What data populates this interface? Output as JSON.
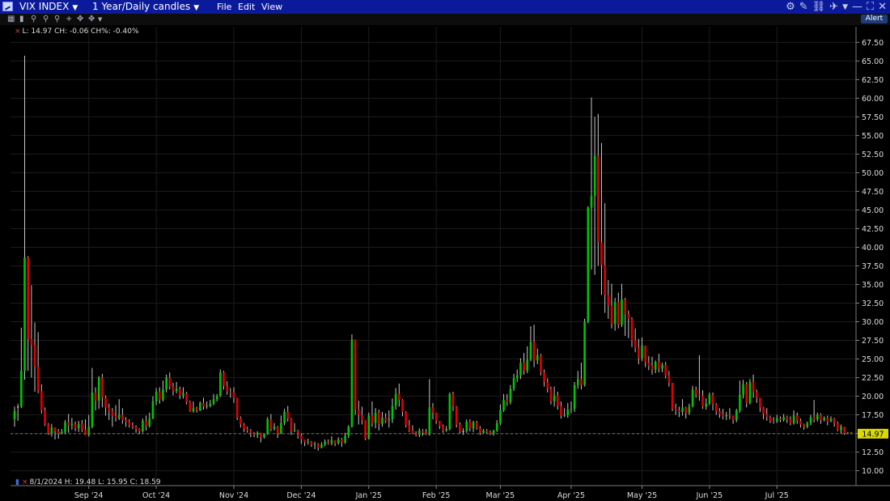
{
  "titlebar": {
    "symbol": "VIX INDEX",
    "period": "1 Year/Daily candles",
    "menu": {
      "file": "File",
      "edit": "Edit",
      "view": "View"
    },
    "alert_label": "Alert"
  },
  "legend_top": "L: 14.97 CH: -0.06 CH%: -0.40%",
  "legend_bottom": "8/1/2024  H: 19.48  L: 15.95  C: 18.59",
  "last_price_label": "14.97",
  "colors": {
    "up": "#00c400",
    "down": "#e00000",
    "doji": "#c8c8c8",
    "background": "#000000",
    "price_tag": "#dada00"
  },
  "chart_data": {
    "type": "candlestick",
    "ylim": [
      8.0,
      69.6
    ],
    "yticks": [
      10,
      12.5,
      15,
      17.5,
      20,
      22.5,
      25,
      27.5,
      30,
      32.5,
      35,
      37.5,
      40,
      42.5,
      45,
      47.5,
      50,
      52.5,
      55,
      57.5,
      60,
      62.5,
      65,
      67.5
    ],
    "ytick_labels": [
      "10.00",
      "12.50",
      "15.00",
      "17.50",
      "20.00",
      "22.50",
      "25.00",
      "27.50",
      "30.00",
      "32.50",
      "35.00",
      "37.50",
      "40.00",
      "42.50",
      "45.00",
      "47.50",
      "50.00",
      "52.50",
      "55.00",
      "57.50",
      "60.00",
      "62.50",
      "65.00",
      "67.50"
    ],
    "xticks": [
      {
        "label": "Sep '24",
        "index": 22
      },
      {
        "label": "Oct '24",
        "index": 42
      },
      {
        "label": "Nov '24",
        "index": 65
      },
      {
        "label": "Dec '24",
        "index": 85
      },
      {
        "label": "Jan '25",
        "index": 105
      },
      {
        "label": "Feb '25",
        "index": 125
      },
      {
        "label": "Mar '25",
        "index": 144
      },
      {
        "label": "Apr '25",
        "index": 165
      },
      {
        "label": "May '25",
        "index": 186
      },
      {
        "label": "Jun '25",
        "index": 206
      },
      {
        "label": "Jul '25",
        "index": 226
      }
    ],
    "last_value": 14.97,
    "candles": [
      [
        16.9,
        18.0,
        15.9,
        18.6
      ],
      [
        18.6,
        18.6,
        16.7,
        19.0
      ],
      [
        18.6,
        23.4,
        18.4,
        29.2
      ],
      [
        23.4,
        38.6,
        22.2,
        65.7
      ],
      [
        38.6,
        27.7,
        23.4,
        38.8
      ],
      [
        27.7,
        26.9,
        22.5,
        34.9
      ],
      [
        26.9,
        24.0,
        20.6,
        29.9
      ],
      [
        24.0,
        20.7,
        20.4,
        28.6
      ],
      [
        20.7,
        18.1,
        17.7,
        21.6
      ],
      [
        18.1,
        16.2,
        16.0,
        18.5
      ],
      [
        16.2,
        15.0,
        14.8,
        16.4
      ],
      [
        15.0,
        15.8,
        14.6,
        16.3
      ],
      [
        15.8,
        15.3,
        14.2,
        15.8
      ],
      [
        15.3,
        15.0,
        14.3,
        15.6
      ],
      [
        15.0,
        15.2,
        14.9,
        15.6
      ],
      [
        15.2,
        16.5,
        15.0,
        16.8
      ],
      [
        16.5,
        16.1,
        15.1,
        17.6
      ],
      [
        16.1,
        16.3,
        15.5,
        17.1
      ],
      [
        16.3,
        15.7,
        15.3,
        16.6
      ],
      [
        15.7,
        16.3,
        15.2,
        16.7
      ],
      [
        16.3,
        15.5,
        15.2,
        16.8
      ],
      [
        15.5,
        14.8,
        14.8,
        16.9
      ],
      [
        14.8,
        15.9,
        14.6,
        17.5
      ],
      [
        15.9,
        20.5,
        15.7,
        23.8
      ],
      [
        20.5,
        19.4,
        18.1,
        21.2
      ],
      [
        19.4,
        22.5,
        18.3,
        22.7
      ],
      [
        22.5,
        19.8,
        18.5,
        23.0
      ],
      [
        19.8,
        18.5,
        17.4,
        20.1
      ],
      [
        18.5,
        18.0,
        16.8,
        19.0
      ],
      [
        18.0,
        17.4,
        15.9,
        18.4
      ],
      [
        17.4,
        17.1,
        16.6,
        18.8
      ],
      [
        17.1,
        17.5,
        16.8,
        19.6
      ],
      [
        17.5,
        16.8,
        16.3,
        18.4
      ],
      [
        16.8,
        16.6,
        15.9,
        17.2
      ],
      [
        16.6,
        16.1,
        15.8,
        16.9
      ],
      [
        16.1,
        15.9,
        15.6,
        16.5
      ],
      [
        15.9,
        15.6,
        15.1,
        16.1
      ],
      [
        15.6,
        15.3,
        14.9,
        15.7
      ],
      [
        15.3,
        16.7,
        15.1,
        17.0
      ],
      [
        16.7,
        16.0,
        15.4,
        17.4
      ],
      [
        16.0,
        17.0,
        15.8,
        17.8
      ],
      [
        17.0,
        19.3,
        16.9,
        20.0
      ],
      [
        19.3,
        20.6,
        18.8,
        21.1
      ],
      [
        20.6,
        19.5,
        19.0,
        21.2
      ],
      [
        19.5,
        20.9,
        19.3,
        22.1
      ],
      [
        20.9,
        22.5,
        20.5,
        22.9
      ],
      [
        22.5,
        21.3,
        20.9,
        23.2
      ],
      [
        21.3,
        20.7,
        20.1,
        21.8
      ],
      [
        20.7,
        21.0,
        20.4,
        21.9
      ],
      [
        21.0,
        20.1,
        19.6,
        21.3
      ],
      [
        20.1,
        20.4,
        19.7,
        21.2
      ],
      [
        20.4,
        19.2,
        18.9,
        20.6
      ],
      [
        19.2,
        18.0,
        17.9,
        19.4
      ],
      [
        18.0,
        18.4,
        17.8,
        19.3
      ],
      [
        18.4,
        18.1,
        17.8,
        18.6
      ],
      [
        18.1,
        19.1,
        18.0,
        19.3
      ],
      [
        19.1,
        18.6,
        18.2,
        19.8
      ],
      [
        18.6,
        18.7,
        18.3,
        19.3
      ],
      [
        18.7,
        19.0,
        18.5,
        19.5
      ],
      [
        19.0,
        19.6,
        18.8,
        20.3
      ],
      [
        19.6,
        20.0,
        19.3,
        20.3
      ],
      [
        20.0,
        23.2,
        19.9,
        23.6
      ],
      [
        23.2,
        21.4,
        20.9,
        23.4
      ],
      [
        21.4,
        20.6,
        20.2,
        22.0
      ],
      [
        20.6,
        20.5,
        19.8,
        21.1
      ],
      [
        20.5,
        19.8,
        19.1,
        21.2
      ],
      [
        19.8,
        17.1,
        16.8,
        19.8
      ],
      [
        17.1,
        16.2,
        15.8,
        17.3
      ],
      [
        16.2,
        15.6,
        15.2,
        16.4
      ],
      [
        15.6,
        15.4,
        15.1,
        15.9
      ],
      [
        15.4,
        15.1,
        14.5,
        15.6
      ],
      [
        15.1,
        14.8,
        14.5,
        15.2
      ],
      [
        14.8,
        15.1,
        14.4,
        15.3
      ],
      [
        15.1,
        14.5,
        13.8,
        15.1
      ],
      [
        14.5,
        14.9,
        14.3,
        15.0
      ],
      [
        14.9,
        16.9,
        14.8,
        17.2
      ],
      [
        16.9,
        15.6,
        15.3,
        17.6
      ],
      [
        15.6,
        15.9,
        15.4,
        16.4
      ],
      [
        15.9,
        15.0,
        14.4,
        16.0
      ],
      [
        15.0,
        16.4,
        14.9,
        17.4
      ],
      [
        16.4,
        17.9,
        16.1,
        18.3
      ],
      [
        17.9,
        17.0,
        16.6,
        18.7
      ],
      [
        17.0,
        15.3,
        14.8,
        17.1
      ],
      [
        15.3,
        15.4,
        15.2,
        16.4
      ],
      [
        15.4,
        14.7,
        14.3,
        15.5
      ],
      [
        14.7,
        14.2,
        13.6,
        15.0
      ],
      [
        14.2,
        13.8,
        13.3,
        14.2
      ],
      [
        13.8,
        13.9,
        13.5,
        14.3
      ],
      [
        13.9,
        13.5,
        13.2,
        14.0
      ],
      [
        13.5,
        13.6,
        12.9,
        13.9
      ],
      [
        13.6,
        13.1,
        12.7,
        13.7
      ],
      [
        13.1,
        13.5,
        13.0,
        13.8
      ],
      [
        13.5,
        13.9,
        13.3,
        14.2
      ],
      [
        13.9,
        13.7,
        13.5,
        14.2
      ],
      [
        13.7,
        14.1,
        13.4,
        14.6
      ],
      [
        14.1,
        13.7,
        13.3,
        14.1
      ],
      [
        13.7,
        14.2,
        13.5,
        14.5
      ],
      [
        14.2,
        13.8,
        13.2,
        14.4
      ],
      [
        13.8,
        14.7,
        13.6,
        15.1
      ],
      [
        14.7,
        15.9,
        14.4,
        16.1
      ],
      [
        15.9,
        27.6,
        15.8,
        28.3
      ],
      [
        27.6,
        18.2,
        17.5,
        27.6
      ],
      [
        18.2,
        17.5,
        16.2,
        19.4
      ],
      [
        17.5,
        16.8,
        16.2,
        18.6
      ],
      [
        16.8,
        14.3,
        14.1,
        16.8
      ],
      [
        14.3,
        17.4,
        14.2,
        17.8
      ],
      [
        17.4,
        16.4,
        15.9,
        19.3
      ],
      [
        16.4,
        17.8,
        15.7,
        18.4
      ],
      [
        17.8,
        16.3,
        15.4,
        18.2
      ],
      [
        16.3,
        17.1,
        15.9,
        17.9
      ],
      [
        17.1,
        16.7,
        16.4,
        17.7
      ],
      [
        16.7,
        16.9,
        15.8,
        18.1
      ],
      [
        16.9,
        18.7,
        16.4,
        19.7
      ],
      [
        18.7,
        20.3,
        18.2,
        21.1
      ],
      [
        20.3,
        19.5,
        18.6,
        21.7
      ],
      [
        19.5,
        17.9,
        17.3,
        19.6
      ],
      [
        17.9,
        16.1,
        15.8,
        18.0
      ],
      [
        16.1,
        15.4,
        15.2,
        16.8
      ],
      [
        15.4,
        15.0,
        14.9,
        16.1
      ],
      [
        15.0,
        14.8,
        14.6,
        15.3
      ],
      [
        14.8,
        15.4,
        14.5,
        15.7
      ],
      [
        15.4,
        15.1,
        14.7,
        15.6
      ],
      [
        15.1,
        14.9,
        14.8,
        15.6
      ],
      [
        14.9,
        18.5,
        14.7,
        22.3
      ],
      [
        18.5,
        17.8,
        16.9,
        19.1
      ],
      [
        17.8,
        16.7,
        16.3,
        17.8
      ],
      [
        16.7,
        16.0,
        15.6,
        16.7
      ],
      [
        16.0,
        15.4,
        15.1,
        16.2
      ],
      [
        15.4,
        15.6,
        15.2,
        16.0
      ],
      [
        15.6,
        20.3,
        15.4,
        20.5
      ],
      [
        20.3,
        18.6,
        18.0,
        20.6
      ],
      [
        18.6,
        16.2,
        15.8,
        18.7
      ],
      [
        16.2,
        15.3,
        15.0,
        16.5
      ],
      [
        15.3,
        15.3,
        14.8,
        15.7
      ],
      [
        15.3,
        16.6,
        15.1,
        16.9
      ],
      [
        16.6,
        15.7,
        15.3,
        16.9
      ],
      [
        15.7,
        16.5,
        15.2,
        16.7
      ],
      [
        16.5,
        15.7,
        15.5,
        16.7
      ],
      [
        15.7,
        15.1,
        14.8,
        16.0
      ],
      [
        15.1,
        15.4,
        14.9,
        15.6
      ],
      [
        15.4,
        15.2,
        15.0,
        15.6
      ],
      [
        15.2,
        15.0,
        14.8,
        15.4
      ],
      [
        15.0,
        15.4,
        14.7,
        15.5
      ],
      [
        15.4,
        16.4,
        15.2,
        16.8
      ],
      [
        16.4,
        18.1,
        16.1,
        18.9
      ],
      [
        18.1,
        19.5,
        17.9,
        20.3
      ],
      [
        19.5,
        19.2,
        18.7,
        20.3
      ],
      [
        19.2,
        21.0,
        18.9,
        21.5
      ],
      [
        21.0,
        22.4,
        20.7,
        23.0
      ],
      [
        22.4,
        22.8,
        21.9,
        23.6
      ],
      [
        22.8,
        24.5,
        22.3,
        25.1
      ],
      [
        24.5,
        23.4,
        22.9,
        25.8
      ],
      [
        23.4,
        24.9,
        23.1,
        26.7
      ],
      [
        24.9,
        27.3,
        24.7,
        29.4
      ],
      [
        27.3,
        24.8,
        23.9,
        29.6
      ],
      [
        24.8,
        25.5,
        24.3,
        26.4
      ],
      [
        25.5,
        23.2,
        22.8,
        25.7
      ],
      [
        23.2,
        21.9,
        21.3,
        23.6
      ],
      [
        21.9,
        21.0,
        20.5,
        22.4
      ],
      [
        21.0,
        19.3,
        18.9,
        21.3
      ],
      [
        19.3,
        20.1,
        18.6,
        21.3
      ],
      [
        20.1,
        18.7,
        18.2,
        20.6
      ],
      [
        18.7,
        17.4,
        17.0,
        19.3
      ],
      [
        17.4,
        17.5,
        17.2,
        18.4
      ],
      [
        17.5,
        18.2,
        17.1,
        19.1
      ],
      [
        18.2,
        18.3,
        17.7,
        19.3
      ],
      [
        18.3,
        21.5,
        17.9,
        21.9
      ],
      [
        21.5,
        22.3,
        21.0,
        23.4
      ],
      [
        22.3,
        21.5,
        20.9,
        24.5
      ],
      [
        21.5,
        30.0,
        21.3,
        30.4
      ],
      [
        30.0,
        45.3,
        29.8,
        45.5
      ],
      [
        45.3,
        46.9,
        37.0,
        60.1
      ],
      [
        46.9,
        52.3,
        36.3,
        57.5
      ],
      [
        52.3,
        40.7,
        37.5,
        57.9
      ],
      [
        40.7,
        37.6,
        33.6,
        54.0
      ],
      [
        37.6,
        33.6,
        31.2,
        45.9
      ],
      [
        33.6,
        32.2,
        30.4,
        35.6
      ],
      [
        32.2,
        29.7,
        29.1,
        35.1
      ],
      [
        29.7,
        32.6,
        28.8,
        33.2
      ],
      [
        32.6,
        29.6,
        29.1,
        33.9
      ],
      [
        29.6,
        33.0,
        29.3,
        35.1
      ],
      [
        33.0,
        31.0,
        28.1,
        33.2
      ],
      [
        31.0,
        30.4,
        27.8,
        31.5
      ],
      [
        30.4,
        27.5,
        26.6,
        30.6
      ],
      [
        27.5,
        26.5,
        25.9,
        29.1
      ],
      [
        26.5,
        25.1,
        24.3,
        27.7
      ],
      [
        25.1,
        26.8,
        24.7,
        27.9
      ],
      [
        26.8,
        24.5,
        23.9,
        26.7
      ],
      [
        24.5,
        24.1,
        23.5,
        25.4
      ],
      [
        24.1,
        23.6,
        22.9,
        25.3
      ],
      [
        23.6,
        24.6,
        23.1,
        24.8
      ],
      [
        24.6,
        23.7,
        23.2,
        25.7
      ],
      [
        23.7,
        24.2,
        23.2,
        24.5
      ],
      [
        24.2,
        22.8,
        22.4,
        24.6
      ],
      [
        22.8,
        21.8,
        21.3,
        23.4
      ],
      [
        21.8,
        18.3,
        18.0,
        21.5
      ],
      [
        18.3,
        18.1,
        17.5,
        19.0
      ],
      [
        18.1,
        17.9,
        17.2,
        18.6
      ],
      [
        17.9,
        18.5,
        17.4,
        19.6
      ],
      [
        18.5,
        17.8,
        17.0,
        18.6
      ],
      [
        17.8,
        18.6,
        17.5,
        19.0
      ],
      [
        18.6,
        20.9,
        18.5,
        21.4
      ],
      [
        20.9,
        20.2,
        19.8,
        21.3
      ],
      [
        20.2,
        20.1,
        19.4,
        25.5
      ],
      [
        20.1,
        18.6,
        18.3,
        20.8
      ],
      [
        18.6,
        19.0,
        18.2,
        19.7
      ],
      [
        19.0,
        20.2,
        18.8,
        20.5
      ],
      [
        20.2,
        18.9,
        18.1,
        20.5
      ],
      [
        18.9,
        18.0,
        17.5,
        19.1
      ],
      [
        18.0,
        17.6,
        17.1,
        18.4
      ],
      [
        17.6,
        17.3,
        16.9,
        18.3
      ],
      [
        17.3,
        17.5,
        16.8,
        17.9
      ],
      [
        17.5,
        17.4,
        16.9,
        18.4
      ],
      [
        17.4,
        16.8,
        16.3,
        17.4
      ],
      [
        16.8,
        18.1,
        16.5,
        18.3
      ],
      [
        18.1,
        20.2,
        17.8,
        22.1
      ],
      [
        20.2,
        21.6,
        19.7,
        22.2
      ],
      [
        21.6,
        19.1,
        18.5,
        21.9
      ],
      [
        19.1,
        21.9,
        18.9,
        22.3
      ],
      [
        21.9,
        20.6,
        19.8,
        22.9
      ],
      [
        20.6,
        19.8,
        19.1,
        20.9
      ],
      [
        19.8,
        18.5,
        17.9,
        19.2
      ],
      [
        18.5,
        17.6,
        16.9,
        18.6
      ],
      [
        17.6,
        17.2,
        16.7,
        18.4
      ],
      [
        17.2,
        16.7,
        16.4,
        17.4
      ],
      [
        16.7,
        16.6,
        16.3,
        17.2
      ],
      [
        16.6,
        17.0,
        16.4,
        17.5
      ],
      [
        17.0,
        16.8,
        16.5,
        17.3
      ],
      [
        16.8,
        17.2,
        16.6,
        17.6
      ],
      [
        17.2,
        16.9,
        16.4,
        17.4
      ],
      [
        16.9,
        16.4,
        16.1,
        17.3
      ],
      [
        16.4,
        17.4,
        16.2,
        18.1
      ],
      [
        17.4,
        16.7,
        16.3,
        17.8
      ],
      [
        16.7,
        16.2,
        15.8,
        17.0
      ],
      [
        16.2,
        15.9,
        15.5,
        16.3
      ],
      [
        15.9,
        16.4,
        15.7,
        16.6
      ],
      [
        16.4,
        17.2,
        16.1,
        17.5
      ],
      [
        17.2,
        16.9,
        16.5,
        19.5
      ],
      [
        16.9,
        17.5,
        16.6,
        17.8
      ],
      [
        17.5,
        16.8,
        16.3,
        17.7
      ],
      [
        16.8,
        17.1,
        16.6,
        17.3
      ],
      [
        17.1,
        16.6,
        16.1,
        17.4
      ],
      [
        16.6,
        17.0,
        16.5,
        17.3
      ],
      [
        17.0,
        16.4,
        15.9,
        17.1
      ],
      [
        16.4,
        15.4,
        15.3,
        16.6
      ],
      [
        15.4,
        15.9,
        15.0,
        16.2
      ],
      [
        15.9,
        15.0,
        14.8,
        15.4
      ],
      [
        15.0,
        15.1,
        14.9,
        15.2
      ],
      [
        15.1,
        14.97,
        14.9,
        15.2
      ]
    ]
  }
}
